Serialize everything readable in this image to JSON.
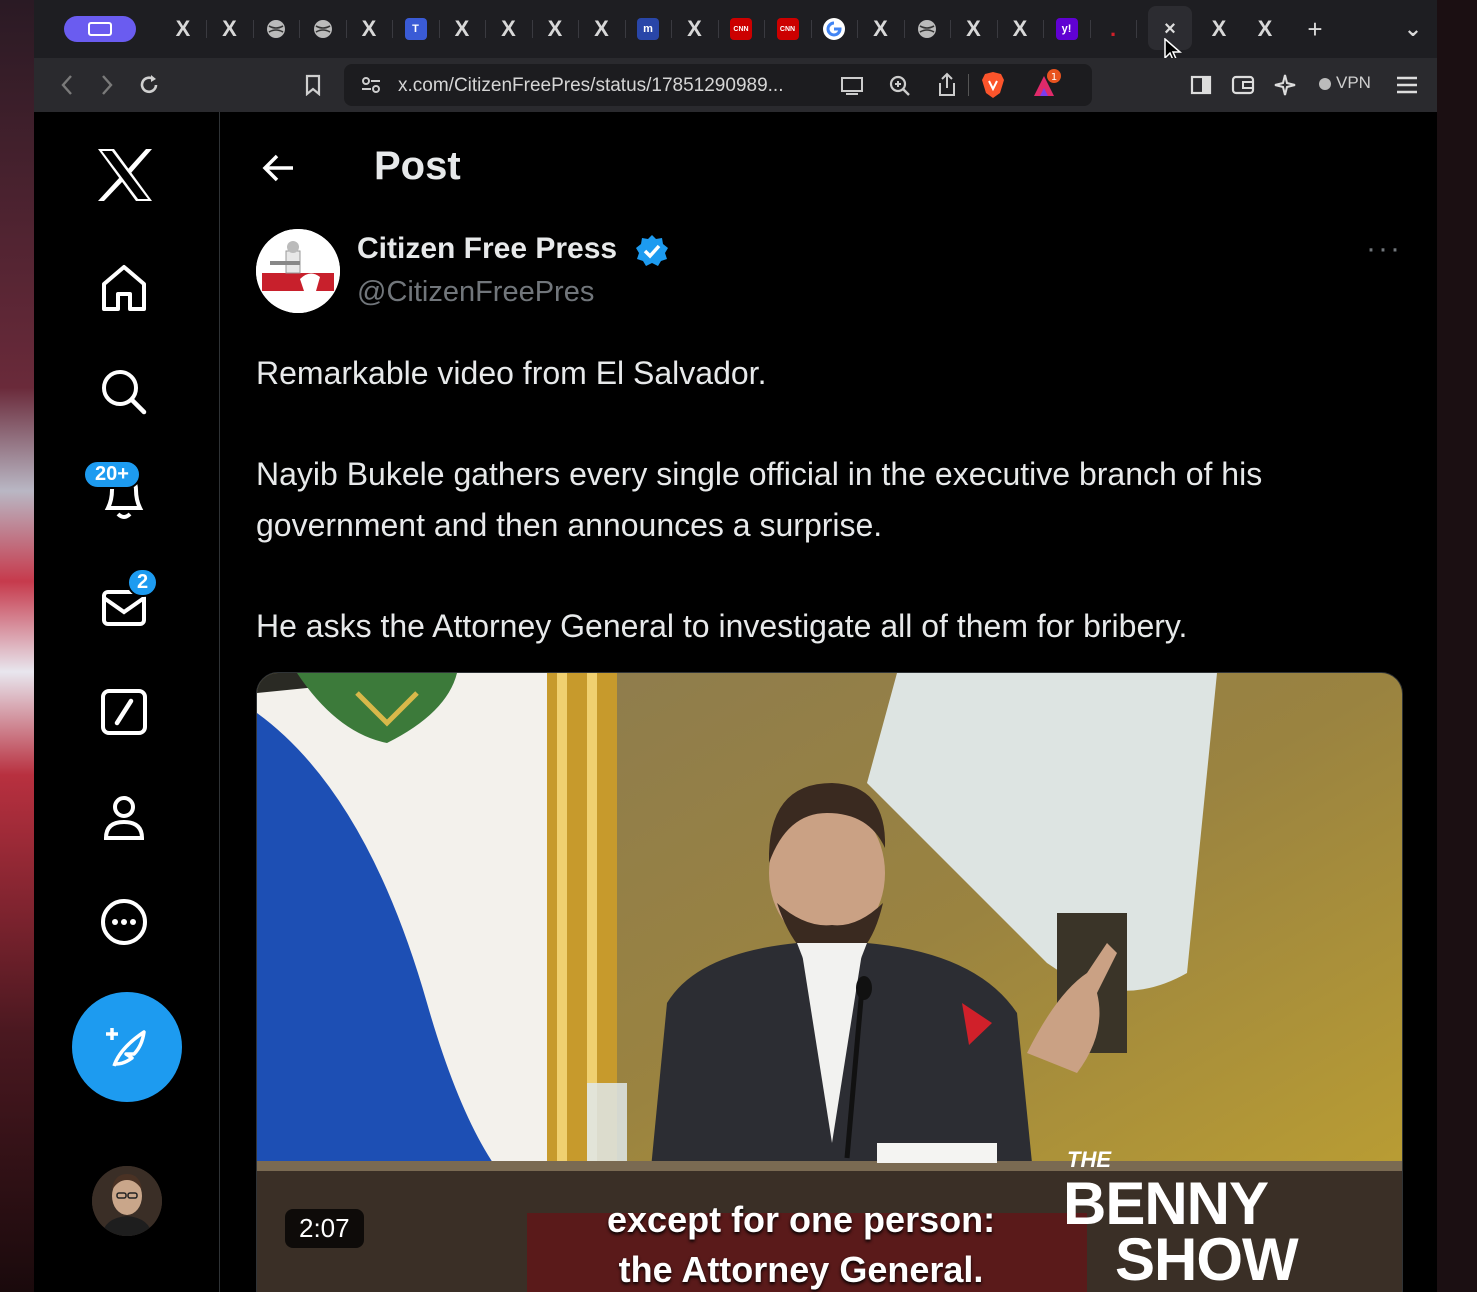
{
  "browser": {
    "tabs": [
      {
        "icon": "x-icon",
        "label": "X"
      },
      {
        "icon": "x-icon",
        "label": "X"
      },
      {
        "icon": "globe-icon",
        "label": ""
      },
      {
        "icon": "globe-icon",
        "label": ""
      },
      {
        "icon": "x-icon",
        "label": "X"
      },
      {
        "icon": "t-app-icon",
        "label": "T"
      },
      {
        "icon": "x-icon",
        "label": "X"
      },
      {
        "icon": "x-icon",
        "label": "X"
      },
      {
        "icon": "x-icon",
        "label": "X"
      },
      {
        "icon": "x-icon",
        "label": "X"
      },
      {
        "icon": "news-icon",
        "label": "m"
      },
      {
        "icon": "x-icon",
        "label": "X"
      },
      {
        "icon": "cnn-icon",
        "label": "CNN"
      },
      {
        "icon": "cnn-icon",
        "label": "CNN"
      },
      {
        "icon": "google-icon",
        "label": "G"
      },
      {
        "icon": "x-icon",
        "label": "X"
      },
      {
        "icon": "globe-icon",
        "label": ""
      },
      {
        "icon": "x-icon",
        "label": "X"
      },
      {
        "icon": "x-icon",
        "label": "X"
      },
      {
        "icon": "yahoo-icon",
        "label": "y!"
      },
      {
        "icon": "dot-icon",
        "label": "."
      }
    ],
    "active_tab_close": "×",
    "trailing_tabs": [
      "X",
      "X"
    ],
    "new_tab": "+",
    "tab_menu": "⌄",
    "url": "x.com/CitizenFreePres/status/17851290989...",
    "vpn_label": "VPN",
    "colors": {
      "workspace": "#6a5cf0",
      "brave": "#fb542b"
    }
  },
  "sidebar": {
    "notifications_badge": "20+",
    "messages_badge": "2",
    "accent": "#1d9bf0"
  },
  "post": {
    "page_title": "Post",
    "author_name": "Citizen Free Press",
    "handle": "@CitizenFreePres",
    "more": "···",
    "text_1": "Remarkable video from El Salvador.",
    "text_2": "Nayib Bukele gathers every single official in the executive branch of his government and then announces a surprise.",
    "text_3": "He asks the Attorney General to investigate all of them for bribery.",
    "video": {
      "duration": "2:07",
      "caption_line_1": "except for one person:",
      "caption_line_2": "the Attorney General.",
      "logo_the": "THE",
      "logo_benny": "BENNY",
      "logo_show": "SHOW"
    }
  }
}
